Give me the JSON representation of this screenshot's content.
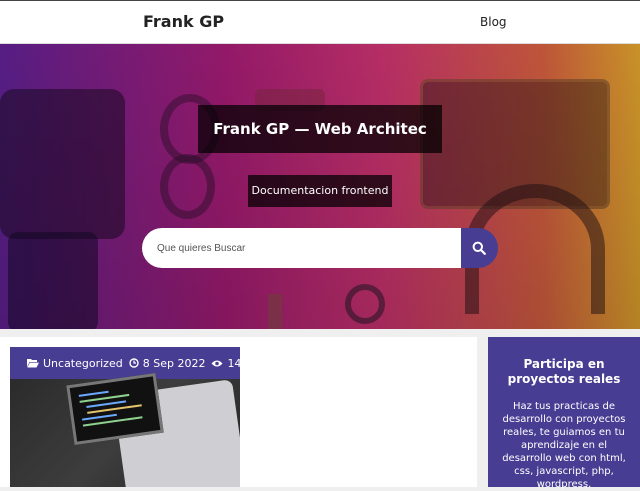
{
  "header": {
    "brand": "Frank GP",
    "nav": [
      {
        "label": "Blog"
      }
    ]
  },
  "hero": {
    "title": "Frank GP — Web Architec",
    "subtitle": "Documentacion frontend",
    "search": {
      "placeholder": "Que quieres Buscar",
      "button_icon": "search-icon"
    }
  },
  "post": {
    "category_icon": "folder-open-icon",
    "category": "Uncategorized",
    "date_icon": "clock-icon",
    "date": "8 Sep 2022",
    "views_icon": "eye-icon",
    "views": "14"
  },
  "sidebar": {
    "title": "Participa en proyectos reales",
    "text": "Haz tus practicas de desarrollo con proyectos reales, te guiamos en tu aprendizaje en el desarrollo web con html, css, javascript, php, wordpress."
  },
  "colors": {
    "accent": "#473e93",
    "background": "#efefef"
  }
}
